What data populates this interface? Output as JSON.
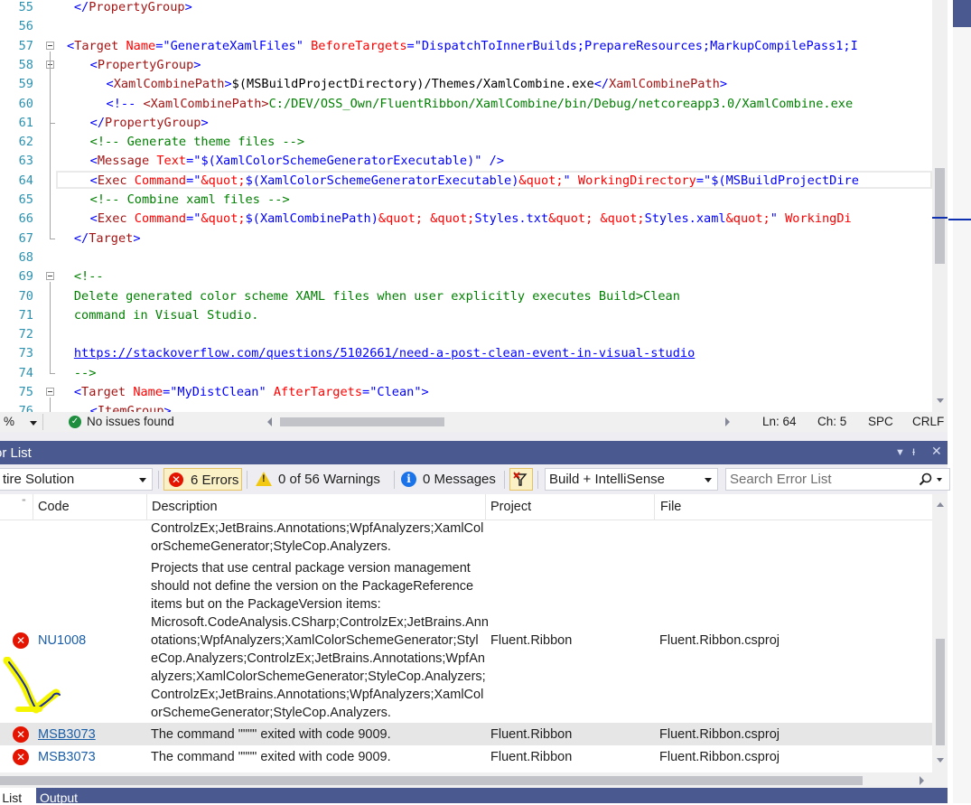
{
  "editor": {
    "lines": [
      {
        "n": "55",
        "parts": [
          [
            "b",
            "</"
          ],
          [
            "t",
            "PropertyGroup"
          ],
          [
            "b",
            ">"
          ]
        ],
        "indent": "  "
      },
      {
        "n": "56",
        "parts": []
      },
      {
        "n": "57",
        "parts": [
          [
            "b",
            "<"
          ],
          [
            "t",
            "Target"
          ],
          [
            "p",
            " "
          ],
          [
            "a",
            "Name"
          ],
          [
            "b",
            "=\""
          ],
          [
            "p",
            ""
          ],
          [
            "b",
            "GenerateXamlFiles\""
          ],
          [
            "p",
            " "
          ],
          [
            "a",
            "BeforeTargets"
          ],
          [
            "b",
            "=\"DispatchToInnerBuilds;PrepareResources;MarkupCompilePass1;I"
          ]
        ]
      },
      {
        "n": "58",
        "parts": [
          [
            "b",
            "<"
          ],
          [
            "t",
            "PropertyGroup"
          ],
          [
            "b",
            ">"
          ]
        ],
        "indent": "    "
      },
      {
        "n": "59",
        "parts": [
          [
            "b",
            "<"
          ],
          [
            "t",
            "XamlCombinePath"
          ],
          [
            "b",
            ">"
          ],
          [
            "p",
            "$(MSBuildProjectDirectory)/Themes/XamlCombine.exe"
          ],
          [
            "b",
            "</"
          ],
          [
            "t",
            "XamlCombinePath"
          ],
          [
            "b",
            ">"
          ]
        ],
        "indent": "      "
      },
      {
        "n": "60",
        "parts": [
          [
            "b",
            "<!-- "
          ],
          [
            "t",
            "<XamlCombinePath>"
          ],
          [
            "g",
            "C:/DEV/OSS_Own/FluentRibbon/XamlCombine/bin/Debug/netcoreapp3.0/XamlCombine.exe"
          ]
        ],
        "indent": "      "
      },
      {
        "n": "61",
        "parts": [
          [
            "b",
            "</"
          ],
          [
            "t",
            "PropertyGroup"
          ],
          [
            "b",
            ">"
          ]
        ],
        "indent": "    "
      },
      {
        "n": "62",
        "parts": [
          [
            "g",
            "<!-- Generate theme files -->"
          ]
        ],
        "indent": "    "
      },
      {
        "n": "63",
        "parts": [
          [
            "b",
            "<"
          ],
          [
            "t",
            "Message"
          ],
          [
            "p",
            " "
          ],
          [
            "a",
            "Text"
          ],
          [
            "b",
            "=\"$(XamlColorSchemeGeneratorExecutable)\""
          ],
          [
            "p",
            " "
          ],
          [
            "b",
            "/>"
          ]
        ],
        "indent": "    "
      },
      {
        "n": "64",
        "parts": [
          [
            "b",
            "<"
          ],
          [
            "t",
            "Exec"
          ],
          [
            "p",
            " "
          ],
          [
            "a",
            "Command"
          ],
          [
            "b",
            "=\""
          ],
          [
            "a",
            "&quot;"
          ],
          [
            "b",
            "$(XamlColorSchemeGeneratorExecutable)"
          ],
          [
            "a",
            "&quot;"
          ],
          [
            "b",
            "\""
          ],
          [
            "p",
            " "
          ],
          [
            "a",
            "WorkingDirectory"
          ],
          [
            "b",
            "=\"$(MSBuildProjectDire"
          ]
        ],
        "indent": "    "
      },
      {
        "n": "65",
        "parts": [
          [
            "g",
            "<!-- Combine xaml files -->"
          ]
        ],
        "indent": "    "
      },
      {
        "n": "66",
        "parts": [
          [
            "b",
            "<"
          ],
          [
            "t",
            "Exec"
          ],
          [
            "p",
            " "
          ],
          [
            "a",
            "Command"
          ],
          [
            "b",
            "=\""
          ],
          [
            "a",
            "&quot;"
          ],
          [
            "b",
            "$(XamlCombinePath)"
          ],
          [
            "a",
            "&quot;"
          ],
          [
            "b",
            " "
          ],
          [
            "a",
            "&quot;"
          ],
          [
            "b",
            "Styles.txt"
          ],
          [
            "a",
            "&quot;"
          ],
          [
            "b",
            " "
          ],
          [
            "a",
            "&quot;"
          ],
          [
            "b",
            "Styles.xaml"
          ],
          [
            "a",
            "&quot;"
          ],
          [
            "b",
            "\""
          ],
          [
            "p",
            " "
          ],
          [
            "a",
            "WorkingDi"
          ]
        ],
        "indent": "    "
      },
      {
        "n": "67",
        "parts": [
          [
            "b",
            "</"
          ],
          [
            "t",
            "Target"
          ],
          [
            "b",
            ">"
          ]
        ],
        "indent": "  "
      },
      {
        "n": "68",
        "parts": []
      },
      {
        "n": "69",
        "parts": [
          [
            "g",
            "<!--"
          ]
        ],
        "indent": "  "
      },
      {
        "n": "70",
        "parts": [
          [
            "g",
            "Delete generated color scheme XAML files when user explicitly executes Build>Clean"
          ]
        ],
        "indent": "  "
      },
      {
        "n": "71",
        "parts": [
          [
            "g",
            "command in Visual Studio."
          ]
        ],
        "indent": "  "
      },
      {
        "n": "72",
        "parts": []
      },
      {
        "n": "73",
        "parts": [
          [
            "u",
            "https://stackoverflow.com/questions/5102661/need-a-post-clean-event-in-visual-studio"
          ]
        ],
        "indent": "  "
      },
      {
        "n": "74",
        "parts": [
          [
            "g",
            "-->"
          ]
        ],
        "indent": "  "
      },
      {
        "n": "75",
        "parts": [
          [
            "b",
            "<"
          ],
          [
            "t",
            "Target"
          ],
          [
            "p",
            " "
          ],
          [
            "a",
            "Name"
          ],
          [
            "b",
            "=\"MyDistClean\""
          ],
          [
            "p",
            " "
          ],
          [
            "a",
            "AfterTargets"
          ],
          [
            "b",
            "=\"Clean\">"
          ]
        ],
        "indent": "  "
      },
      {
        "n": "76",
        "parts": [
          [
            "b",
            "<"
          ],
          [
            "t",
            "ItemGroup"
          ],
          [
            "b",
            ">"
          ]
        ],
        "indent": "    "
      }
    ]
  },
  "status": {
    "zoom": "%",
    "issues": "No issues found",
    "line": "Ln: 64",
    "col": "Ch: 5",
    "spc": "SPC",
    "crlf": "CRLF"
  },
  "error_list": {
    "title": "or List",
    "scope": "tire Solution",
    "errors_label": "6 Errors",
    "warnings_label": "0 of 56 Warnings",
    "messages_label": "0 Messages",
    "build_filter": "Build + IntelliSense",
    "search_placeholder": "Search Error List",
    "columns": {
      "code": "Code",
      "description": "Description",
      "project": "Project",
      "file": "File"
    },
    "rows": [
      {
        "code": "",
        "description": "ControlzEx;JetBrains.Annotations;WpfAnalyzers;XamlCol\norSchemeGenerator;StyleCop.Analyzers.",
        "project": "",
        "file": ""
      },
      {
        "code": "NU1008",
        "description": "Projects that use central package version management\nshould not define the version on the PackageReference\nitems but on the PackageVersion items:\nMicrosoft.CodeAnalysis.CSharp;ControlzEx;JetBrains.Ann\notations;WpfAnalyzers;XamlColorSchemeGenerator;Styl\neCop.Analyzers;ControlzEx;JetBrains.Annotations;WpfAn\nalyzers;XamlColorSchemeGenerator;StyleCop.Analyzers;\nControlzEx;JetBrains.Annotations;WpfAnalyzers;XamlCol\norSchemeGenerator;StyleCop.Analyzers.",
        "project": "Fluent.Ribbon",
        "file": "Fluent.Ribbon.csproj"
      },
      {
        "code": "MSB3073",
        "description": "The command \"\"\"\" exited with code 9009.",
        "project": "Fluent.Ribbon",
        "file": "Fluent.Ribbon.csproj"
      },
      {
        "code": "MSB3073",
        "description": "The command \"\"\"\" exited with code 9009.",
        "project": "Fluent.Ribbon",
        "file": "Fluent.Ribbon.csproj"
      }
    ]
  },
  "tabs": {
    "error_list": "or List",
    "output": "Output"
  },
  "colors": {
    "accent": "#4a5a90",
    "error": "#e51400",
    "warning": "#f2c811",
    "info": "#1a73e8",
    "annotation": "#f5f500"
  },
  "icons": [
    "error-icon",
    "warning-icon",
    "info-icon",
    "filter-icon",
    "search-icon",
    "check-icon"
  ]
}
